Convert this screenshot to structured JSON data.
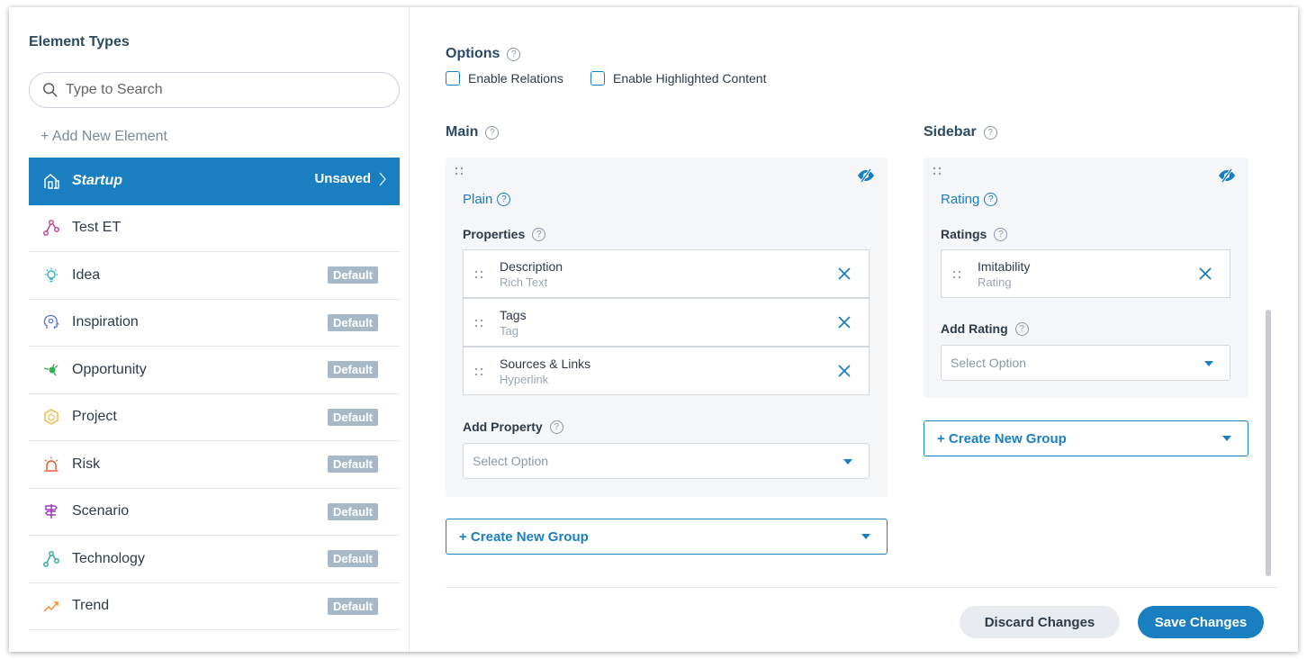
{
  "sidebar": {
    "title": "Element Types",
    "search_placeholder": "Type to Search",
    "add_new": "+ Add New Element",
    "items": [
      {
        "label": "Startup",
        "status": "Unsaved",
        "icon": "building-icon",
        "color": "#ffffff"
      },
      {
        "label": "Test ET",
        "status": "",
        "icon": "network-icon",
        "color": "#c0399a"
      },
      {
        "label": "Idea",
        "status": "Default",
        "icon": "lightbulb-icon",
        "color": "#2bb3c9"
      },
      {
        "label": "Inspiration",
        "status": "Default",
        "icon": "brain-icon",
        "color": "#5a6fd1"
      },
      {
        "label": "Opportunity",
        "status": "Default",
        "icon": "target-icon",
        "color": "#2fb24a"
      },
      {
        "label": "Project",
        "status": "Default",
        "icon": "hexagon-icon",
        "color": "#f0b43b"
      },
      {
        "label": "Risk",
        "status": "Default",
        "icon": "alarm-icon",
        "color": "#e2542a"
      },
      {
        "label": "Scenario",
        "status": "Default",
        "icon": "signpost-icon",
        "color": "#9b3bb8"
      },
      {
        "label": "Technology",
        "status": "Default",
        "icon": "network-icon",
        "color": "#27a99b"
      },
      {
        "label": "Trend",
        "status": "Default",
        "icon": "trend-up-icon",
        "color": "#f08a2b"
      }
    ]
  },
  "options": {
    "title": "Options",
    "enable_relations": "Enable Relations",
    "enable_highlighted": "Enable Highlighted Content"
  },
  "main": {
    "title": "Main",
    "group": {
      "name": "Plain",
      "properties_label": "Properties",
      "properties": [
        {
          "name": "Description",
          "type": "Rich Text"
        },
        {
          "name": "Tags",
          "type": "Tag"
        },
        {
          "name": "Sources & Links",
          "type": "Hyperlink"
        }
      ],
      "add_label": "Add Property",
      "select_placeholder": "Select Option"
    },
    "create_group": "+ Create New Group"
  },
  "sidebar_col": {
    "title": "Sidebar",
    "group": {
      "name": "Rating",
      "ratings_label": "Ratings",
      "ratings": [
        {
          "name": "Imitability",
          "type": "Rating"
        }
      ],
      "add_label": "Add Rating",
      "select_placeholder": "Select Option"
    },
    "create_group": "+ Create New Group"
  },
  "footer": {
    "discard": "Discard Changes",
    "save": "Save Changes"
  },
  "colors": {
    "accent": "#1a7fc1",
    "badge": "#a7b9c6"
  }
}
